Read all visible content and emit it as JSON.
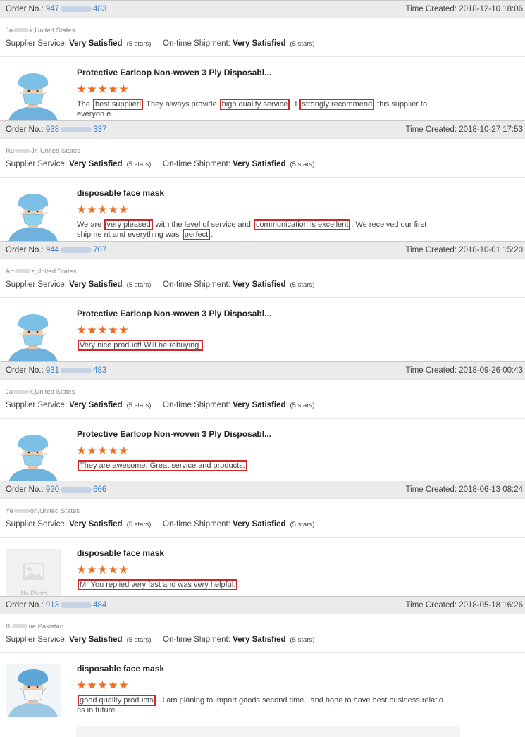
{
  "labels": {
    "order_no": "Order No.:",
    "time_created": "Time Created:",
    "supplier_service": "Supplier Service:",
    "on_time_shipment": "On-time Shipment:",
    "no_photo": "No Photo"
  },
  "orders": [
    {
      "order_no_prefix": "947",
      "order_no_suffix": "483",
      "time_created": "2018-12-10 18:06",
      "buyer_prefix": "Ja",
      "buyer_suffix": "k,United States",
      "supplier_service": "Very Satisfied",
      "supplier_stars": "(5 stars)",
      "shipment": "Very Satisfied",
      "shipment_stars": "(5 stars)",
      "product_title": "Protective Earloop Non-woven 3 Ply Disposabl...",
      "rating": 5,
      "photo": "mask-blue",
      "review": [
        {
          "t": "The "
        },
        {
          "t": "best supplier!",
          "hl": true
        },
        {
          "t": " They always provide "
        },
        {
          "t": "high quality service",
          "hl": true
        },
        {
          "t": ". I "
        },
        {
          "t": "strongly recommend",
          "hl": true
        },
        {
          "t": " this supplier to everyon e."
        }
      ]
    },
    {
      "order_no_prefix": "938",
      "order_no_suffix": "337",
      "time_created": "2018-10-27 17:53",
      "buyer_prefix": "Ru",
      "buyer_suffix": "Jr.,United States",
      "supplier_service": "Very Satisfied",
      "supplier_stars": "(5 stars)",
      "shipment": "Very Satisfied",
      "shipment_stars": "(5 stars)",
      "product_title": "disposable face mask",
      "rating": 5,
      "photo": "mask-blue",
      "review": [
        {
          "t": "We are "
        },
        {
          "t": "very pleased",
          "hl": true
        },
        {
          "t": " with the level of service and "
        },
        {
          "t": "communication is excellent",
          "hl": true
        },
        {
          "t": ". We received our first shipme nt and everything was "
        },
        {
          "t": "perfect",
          "hl": true
        },
        {
          "t": "."
        }
      ]
    },
    {
      "order_no_prefix": "944",
      "order_no_suffix": "707",
      "time_created": "2018-10-01 15:20",
      "buyer_prefix": "Art",
      "buyer_suffix": "z,United States",
      "supplier_service": "Very Satisfied",
      "supplier_stars": "(5 stars)",
      "shipment": "Very Satisfied",
      "shipment_stars": "(5 stars)",
      "product_title": "Protective Earloop Non-woven 3 Ply Disposabl...",
      "rating": 5,
      "photo": "mask-blue",
      "review": [
        {
          "t": "Very nice product!  Will be rebuying.",
          "hl": true
        }
      ]
    },
    {
      "order_no_prefix": "931",
      "order_no_suffix": "483",
      "time_created": "2018-09-26 00:43",
      "buyer_prefix": "Ja",
      "buyer_suffix": "k,United States",
      "supplier_service": "Very Satisfied",
      "supplier_stars": "(5 stars)",
      "shipment": "Very Satisfied",
      "shipment_stars": "(5 stars)",
      "product_title": "Protective Earloop Non-woven 3 Ply Disposabl...",
      "rating": 5,
      "photo": "mask-blue",
      "review": [
        {
          "t": "They are awesome. Great service and products.",
          "hl": true
        }
      ]
    },
    {
      "order_no_prefix": "920",
      "order_no_suffix": "666",
      "time_created": "2018-06-13 08:24",
      "buyer_prefix": "Ye",
      "buyer_suffix": "on,United States",
      "supplier_service": "Very Satisfied",
      "supplier_stars": "(5 stars)",
      "shipment": "Very Satisfied",
      "shipment_stars": "(5 stars)",
      "product_title": "disposable face mask",
      "rating": 5,
      "photo": "none",
      "review": [
        {
          "t": "Mr You replied very fast and was very helpful.",
          "hl": true
        }
      ]
    },
    {
      "order_no_prefix": "913",
      "order_no_suffix": "484",
      "time_created": "2018-05-18 16:26",
      "buyer_prefix": "Bi",
      "buyer_suffix": "ue,Pakistan",
      "supplier_service": "Very Satisfied",
      "supplier_stars": "(5 stars)",
      "shipment": "Very Satisfied",
      "shipment_stars": "(5 stars)",
      "product_title": "disposable face mask",
      "rating": 5,
      "photo": "mask-white",
      "review": [
        {
          "t": "good quality products",
          "hl": true
        },
        {
          "t": "...i am planing to import goods second time...and hope to have best business relatio ns in future...."
        }
      ]
    }
  ]
}
